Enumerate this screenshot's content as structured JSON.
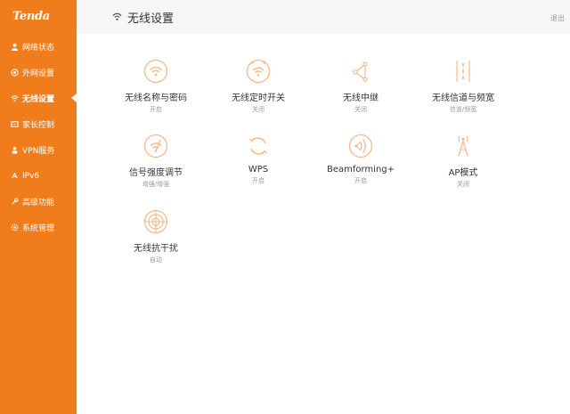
{
  "brand": {
    "logo_text": "Tenda",
    "accent": "#f07c1c",
    "icon_color": "#f5b98a"
  },
  "header": {
    "title": "无线设置",
    "logout": "退出"
  },
  "sidebar": {
    "items": [
      {
        "label": "网络状态",
        "icon": "user-icon"
      },
      {
        "label": "外网设置",
        "icon": "globe-icon"
      },
      {
        "label": "无线设置",
        "icon": "wifi-icon",
        "active": true
      },
      {
        "label": "家长控制",
        "icon": "parental-icon"
      },
      {
        "label": "VPN服务",
        "icon": "person-icon"
      },
      {
        "label": "IPv6",
        "icon": "ipv6-icon"
      },
      {
        "label": "高级功能",
        "icon": "wrench-icon"
      },
      {
        "label": "系统管理",
        "icon": "gear-icon"
      }
    ]
  },
  "tiles": [
    {
      "label": "无线名称与密码",
      "status": "开启",
      "icon": "wifi-circle-icon"
    },
    {
      "label": "无线定时开关",
      "status": "关闭",
      "icon": "wifi-timer-icon"
    },
    {
      "label": "无线中继",
      "status": "关闭",
      "icon": "repeater-icon"
    },
    {
      "label": "无线信道与频宽",
      "status": "信道/频宽",
      "icon": "channel-icon"
    },
    {
      "label": "信号强度调节",
      "status": "增强/增强",
      "icon": "signal-strength-icon"
    },
    {
      "label": "WPS",
      "status": "开启",
      "icon": "wps-icon"
    },
    {
      "label": "Beamforming+",
      "status": "开启",
      "icon": "beamforming-icon"
    },
    {
      "label": "AP模式",
      "status": "关闭",
      "icon": "antenna-icon"
    },
    {
      "label": "无线抗干扰",
      "status": "自动",
      "icon": "anti-interference-icon"
    }
  ]
}
